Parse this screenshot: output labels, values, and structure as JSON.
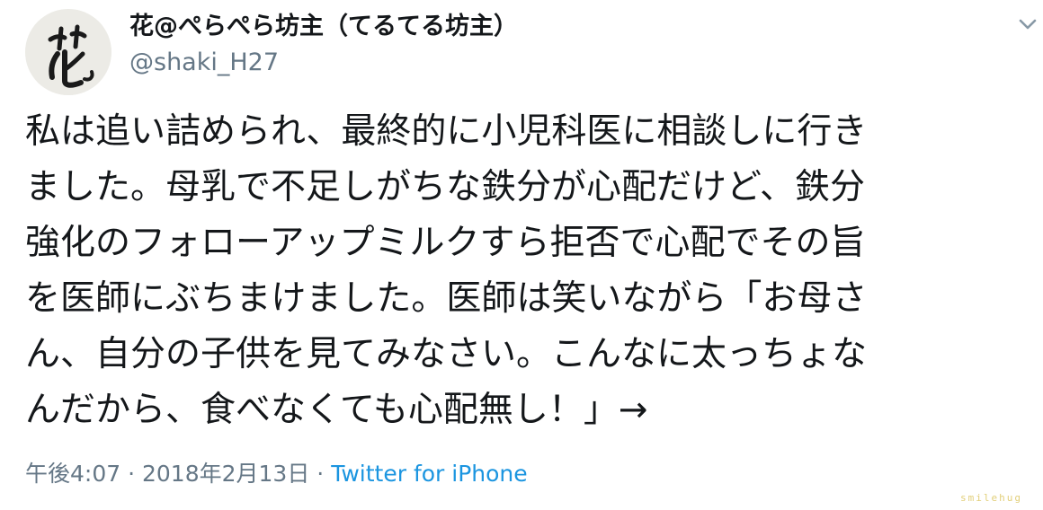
{
  "tweet": {
    "author": {
      "display_name": "花@ぺらぺら坊主（てるてる坊主）",
      "handle": "@shaki_H27",
      "avatar_icon": "calligraphy-avatar-icon"
    },
    "menu_icon": "chevron-down-icon",
    "text_lines": [
      "私は追い詰められ、最終的に小児科医に相談しに行き",
      "ました。母乳で不足しがちな鉄分が心配だけど、鉄分",
      "強化のフォローアップミルクすら拒否で心配でその旨",
      "を医師にぶちまけました。医師は笑いながら「お母さ",
      "ん、自分の子供を見てみなさい。こんなに太っちょな",
      "んだから、食べなくても心配無し！」→"
    ],
    "time": "午後4:07",
    "separator": "·",
    "date": "2018年2月13日",
    "source": "Twitter for iPhone"
  },
  "watermark": "smilehug",
  "colors": {
    "text": "#14171a",
    "muted": "#657786",
    "link": "#1b95e0",
    "background": "#ffffff"
  }
}
